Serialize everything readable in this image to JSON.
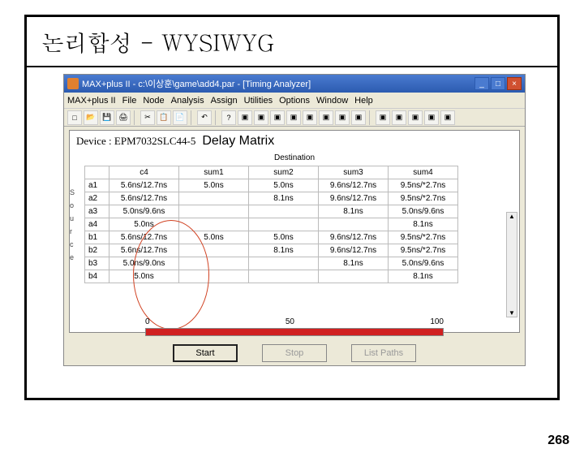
{
  "slide_title": "논리합성 - WYSIWYG",
  "page_number": "268",
  "window": {
    "title": "MAX+plus II - c:\\이상훈\\game\\add4.par - [Timing Analyzer]",
    "menus": [
      "MAX+plus II",
      "File",
      "Node",
      "Analysis",
      "Assign",
      "Utilities",
      "Options",
      "Window",
      "Help"
    ]
  },
  "device_label": "Device : EPM7032SLC44-5",
  "delay_matrix_label": "Delay Matrix",
  "destination_label": "Destination",
  "source_axis": [
    "S",
    "o",
    "u",
    "r",
    "c",
    "e"
  ],
  "columns": [
    "c4",
    "sum1",
    "sum2",
    "sum3",
    "sum4"
  ],
  "rows": [
    {
      "h": "a1",
      "cells": [
        "5.6ns/12.7ns",
        "5.0ns",
        "5.0ns",
        "9.6ns/12.7ns",
        "9.5ns/*2.7ns"
      ]
    },
    {
      "h": "a2",
      "cells": [
        "5.6ns/12.7ns",
        "",
        "8.1ns",
        "9.6ns/12.7ns",
        "9.5ns/*2.7ns"
      ]
    },
    {
      "h": "a3",
      "cells": [
        "5.0ns/9.6ns",
        "",
        "",
        "8.1ns",
        "5.0ns/9.6ns"
      ]
    },
    {
      "h": "a4",
      "cells": [
        "5.0ns",
        "",
        "",
        "",
        "8.1ns"
      ]
    },
    {
      "h": "b1",
      "cells": [
        "5.6ns/12.7ns",
        "5.0ns",
        "5.0ns",
        "9.6ns/12.7ns",
        "9.5ns/*2.7ns"
      ]
    },
    {
      "h": "b2",
      "cells": [
        "5.6ns/12.7ns",
        "",
        "8.1ns",
        "9.6ns/12.7ns",
        "9.5ns/*2.7ns"
      ]
    },
    {
      "h": "b3",
      "cells": [
        "5.0ns/9.0ns",
        "",
        "",
        "8.1ns",
        "5.0ns/9.6ns"
      ]
    },
    {
      "h": "b4",
      "cells": [
        "5.0ns",
        "",
        "",
        "",
        "8.1ns"
      ]
    }
  ],
  "progress": {
    "min": "0",
    "mid": "50",
    "max": "100"
  },
  "buttons": {
    "start": "Start",
    "stop": "Stop",
    "list": "List Paths"
  }
}
